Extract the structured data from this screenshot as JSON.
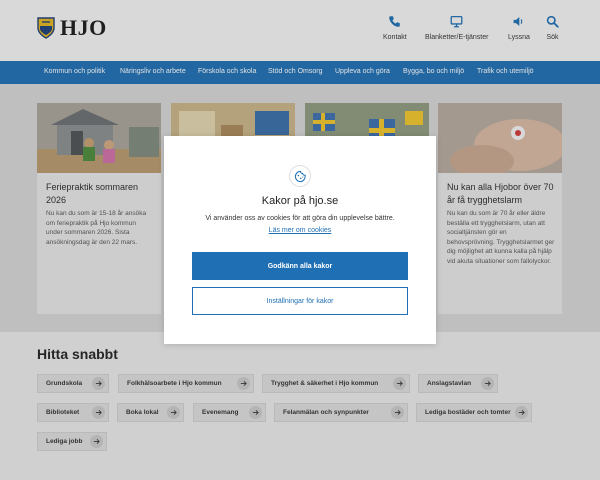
{
  "header": {
    "logo_text": "HJO",
    "nav": [
      {
        "label": "Kontakt",
        "icon": "phone-icon"
      },
      {
        "label": "Blanketter/E-tjänster",
        "icon": "monitor-icon"
      },
      {
        "label": "Lyssna",
        "icon": "speaker-icon"
      },
      {
        "label": "Sök",
        "icon": "search-icon"
      }
    ]
  },
  "main_nav": {
    "items": [
      "Kommun och politik",
      "Näringsliv och arbete",
      "Förskola och skola",
      "Stöd och Omsorg",
      "Uppleva och göra",
      "Bygga, bo och miljö",
      "Trafik och utemiljö"
    ]
  },
  "cards": [
    {
      "title": "Feriepraktik sommaren 2026",
      "body": "Nu kan du som är 15-18 år ansöka om feriepraktik på Hjo kommun under sommaren 2026. Sista ansökningsdag är den 22 mars."
    },
    {
      "title": "",
      "body": ""
    },
    {
      "title": "",
      "body": ""
    },
    {
      "title": "Nu kan alla Hjobor över 70 år få trygghetslarm",
      "body": "Nu kan du som är 70 år eller äldre beställa ett trygghetslarm, utan att socialtjänsten gör en behovsprövning. Trygghetslarmet ger dig möjlighet att kunna kalla på hjälp vid akuta situationer som fallolyckor."
    }
  ],
  "quick": {
    "title": "Hitta snabbt",
    "rows": [
      [
        "Grundskola",
        "Folkhälsoarbete i Hjo kommun",
        "Trygghet & säkerhet i Hjo kommun",
        "Anslagstavlan"
      ],
      [
        "Biblioteket",
        "Boka lokal",
        "Evenemang",
        "Felanmälan och synpunkter",
        "Lediga bostäder och tomter"
      ],
      [
        "Lediga jobb"
      ]
    ]
  },
  "cookie": {
    "title": "Kakor på hjo.se",
    "description": "Vi använder oss av cookies för att göra din upplevelse bättre.",
    "link": "Läs mer om cookies",
    "accept_label": "Godkänn alla kakor",
    "settings_label": "Inställningar för kakor"
  },
  "colors": {
    "brand_blue": "#1f6fb4",
    "logo_yellow": "#e2b51f"
  }
}
